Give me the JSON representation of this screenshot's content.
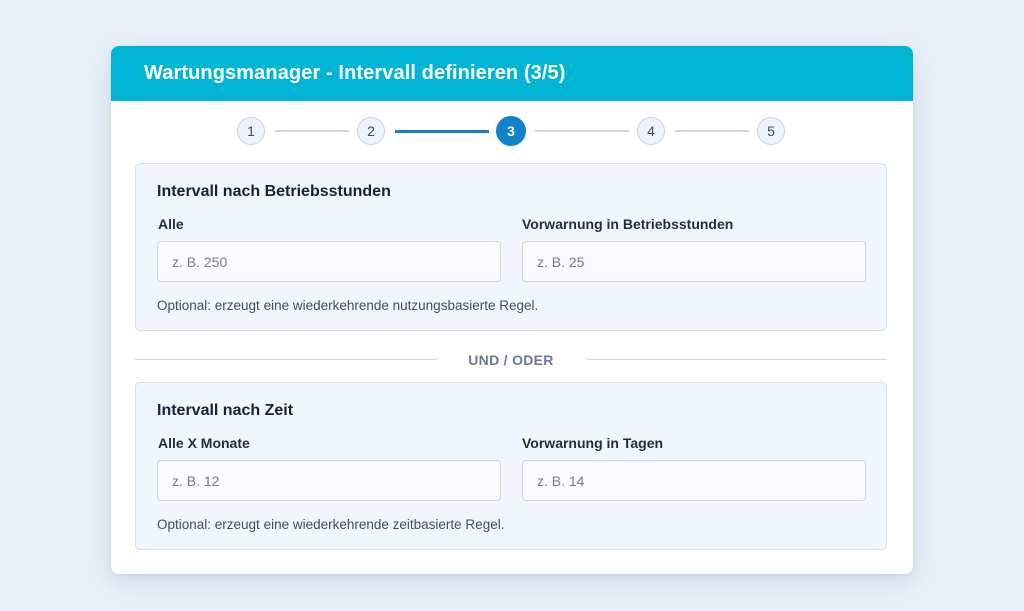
{
  "dialog": {
    "title": "Wartungsmanager - Intervall definieren (3/5)",
    "accent_color": "#03b5d5"
  },
  "stepper": {
    "current_step": 3,
    "steps": [
      "1",
      "2",
      "3",
      "4",
      "5"
    ],
    "active_color": "#1283c9"
  },
  "operating_hours": {
    "heading": "Intervall nach Betriebsstunden",
    "every_label": "Alle",
    "every_value": "",
    "every_placeholder": "z. B. 250",
    "warning_label": "Vorwarnung in Betriebsstunden",
    "warning_value": "",
    "warning_placeholder": "z. B. 25",
    "hint": "Optional: erzeugt eine wiederkehrende nutzungsbasierte Regel."
  },
  "separator": {
    "label": "UND / ODER"
  },
  "time": {
    "heading": "Intervall nach Zeit",
    "months_label": "Alle X Monate",
    "months_value": "",
    "months_placeholder": "z. B. 12",
    "warning_label": "Vorwarnung in Tagen",
    "warning_value": "",
    "warning_placeholder": "z. B. 14",
    "hint": "Optional: erzeugt eine wiederkehrende zeitbasierte Regel."
  }
}
